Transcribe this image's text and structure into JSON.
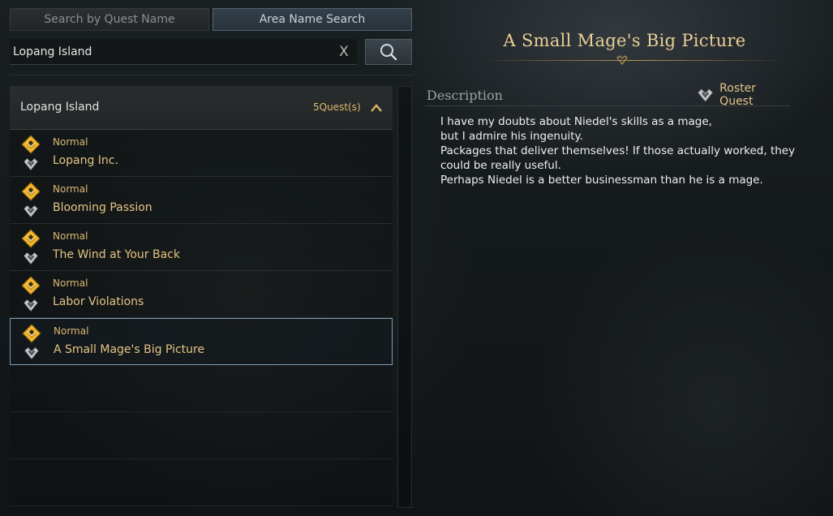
{
  "tabs": [
    {
      "label": "Search by Quest Name",
      "active": false
    },
    {
      "label": "Area Name Search",
      "active": true
    }
  ],
  "search": {
    "value": "Lopang Island",
    "clear_icon": "X",
    "search_icon": "magnifier-icon"
  },
  "group": {
    "title": "Lopang Island",
    "count": "5Quest(s)",
    "expanded": true
  },
  "quests": [
    {
      "type": "Normal",
      "name": "Lopang Inc.",
      "selected": false
    },
    {
      "type": "Normal",
      "name": "Blooming Passion",
      "selected": false
    },
    {
      "type": "Normal",
      "name": "The Wind at Your Back",
      "selected": false
    },
    {
      "type": "Normal",
      "name": "Labor Violations",
      "selected": false
    },
    {
      "type": "Normal",
      "name": "A Small Mage's Big Picture",
      "selected": true
    }
  ],
  "detail": {
    "title": "A Small Mage's Big Picture",
    "description_label": "Description",
    "roster_label": "Roster Quest",
    "description_lines": [
      "I have my doubts about Niedel's skills as a mage,",
      "but I admire his ingenuity.",
      "Packages that deliver themselves! If those actually worked, they",
      "could be really useful.",
      "Perhaps Niedel is a better businessman than he is a mage."
    ]
  },
  "colors": {
    "gold_text": "#e4c485",
    "selected_border": "#7b9db6",
    "accent_gold_icon": "#f0b52a"
  }
}
